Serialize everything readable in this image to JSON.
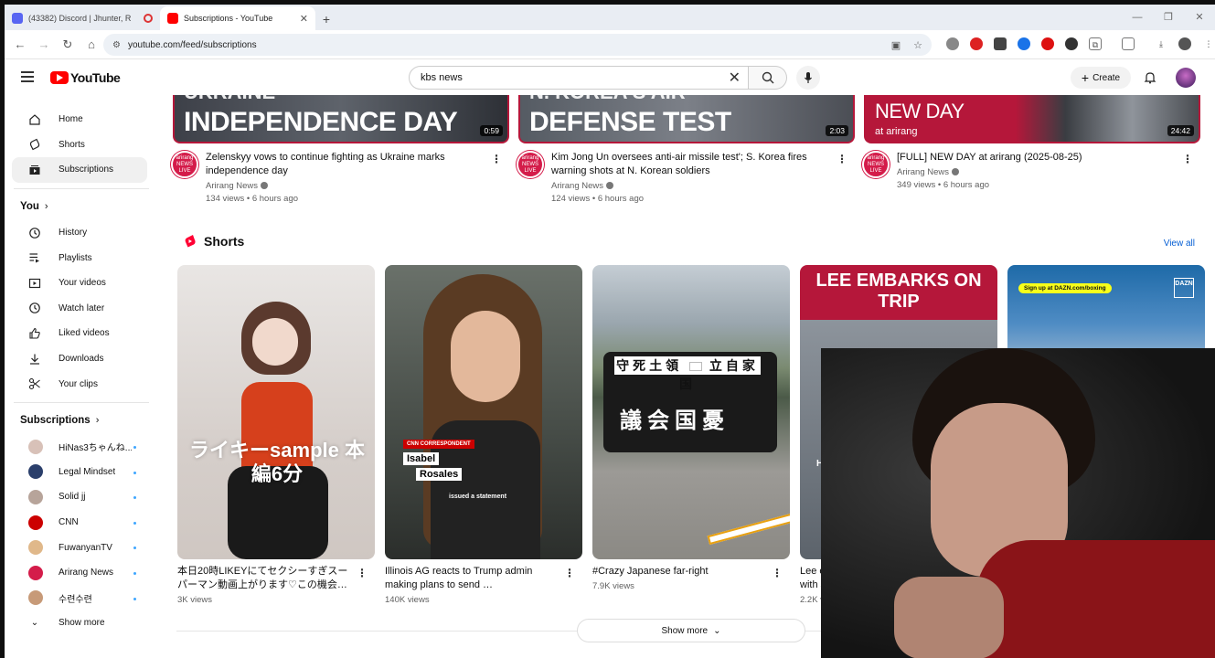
{
  "browser": {
    "tabs": [
      {
        "title": "(43382) Discord | Jhunter, R",
        "active": false
      },
      {
        "title": "Subscriptions - YouTube",
        "active": true
      }
    ],
    "url": "youtube.com/feed/subscriptions"
  },
  "masthead": {
    "logo": "YouTube",
    "search_value": "kbs news",
    "create_label": "Create"
  },
  "sidebar": {
    "main": [
      {
        "label": "Home",
        "icon": "home-icon"
      },
      {
        "label": "Shorts",
        "icon": "shorts-icon"
      },
      {
        "label": "Subscriptions",
        "icon": "subscriptions-icon",
        "active": true
      }
    ],
    "you_header": "You",
    "you": [
      {
        "label": "History",
        "icon": "history-icon"
      },
      {
        "label": "Playlists",
        "icon": "playlists-icon"
      },
      {
        "label": "Your videos",
        "icon": "your-videos-icon"
      },
      {
        "label": "Watch later",
        "icon": "watch-later-icon"
      },
      {
        "label": "Liked videos",
        "icon": "thumbs-up-icon"
      },
      {
        "label": "Downloads",
        "icon": "download-icon"
      },
      {
        "label": "Your clips",
        "icon": "scissors-icon"
      }
    ],
    "subs_header": "Subscriptions",
    "subscriptions": [
      {
        "label": "HiNas3ちゃんね...",
        "color": "#d8c1b8"
      },
      {
        "label": "Legal Mindset",
        "color": "#2b3f6b"
      },
      {
        "label": "Solid jj",
        "color": "#b7a49a"
      },
      {
        "label": "CNN",
        "color": "#cc0000"
      },
      {
        "label": "FuwanyanTV",
        "color": "#e0b88a"
      },
      {
        "label": "Arirang News",
        "color": "#d41c4a"
      },
      {
        "label": "수련수련",
        "color": "#c79a78"
      }
    ],
    "show_more": "Show more"
  },
  "videos": [
    {
      "thumb_text": "INDEPENDENCE DAY",
      "thumb_top": "UKRAINE",
      "duration": "0:59",
      "title": "Zelenskyy vows to continue fighting as Ukraine marks independence day",
      "channel": "Arirang News",
      "stats": "134 views • 6 hours ago"
    },
    {
      "thumb_text": "DEFENSE TEST",
      "thumb_top": "N. KOREA'S AIR",
      "duration": "2:03",
      "title": "Kim Jong Un oversees anti-air missile test'; S. Korea fires warning shots at N. Korean soldiers",
      "channel": "Arirang News",
      "stats": "124 views • 6 hours ago"
    },
    {
      "thumb_text": "NEW DAY",
      "thumb_top": "",
      "thumb_sub": "at arirang",
      "duration": "24:42",
      "title": "[FULL] NEW DAY at arirang (2025-08-25)",
      "channel": "Arirang News",
      "stats": "349 views • 6 hours ago"
    }
  ],
  "channel_avatar_text": "arirang NEWS LIVE",
  "shorts": {
    "header": "Shorts",
    "view_all": "View all",
    "items": [
      {
        "title": "本日20時LIKEYにてセクシーすぎスーパーマン動画上がります♡この機会…",
        "views": "3K views",
        "overlay": "ライキーsample 本編6分"
      },
      {
        "title": "Illinois AG reacts to Trump admin making plans to send …",
        "views": "140K views",
        "overlay_label": "CNN CORRESPONDENT",
        "overlay_name1": "Isabel",
        "overlay_name2": "Rosales",
        "overlay_caption": "issued a statement"
      },
      {
        "title": "#Crazy Japanese far-right",
        "views": "7.9K views",
        "overlay_top": "守死土領",
        "overlay_top2": "立自家国",
        "overlay_bottom": "議会国憂"
      },
      {
        "title": "Lee e",
        "title2": "with J",
        "views": "2.2K v",
        "overlay": "LEE EMBARKS ON TRIP",
        "overlay_small": "He"
      },
      {
        "title": "",
        "views": "",
        "overlay": "Sign up at DAZN.com/boxing",
        "overlay_logo": "DAZN"
      }
    ]
  },
  "show_more_main": "Show more"
}
